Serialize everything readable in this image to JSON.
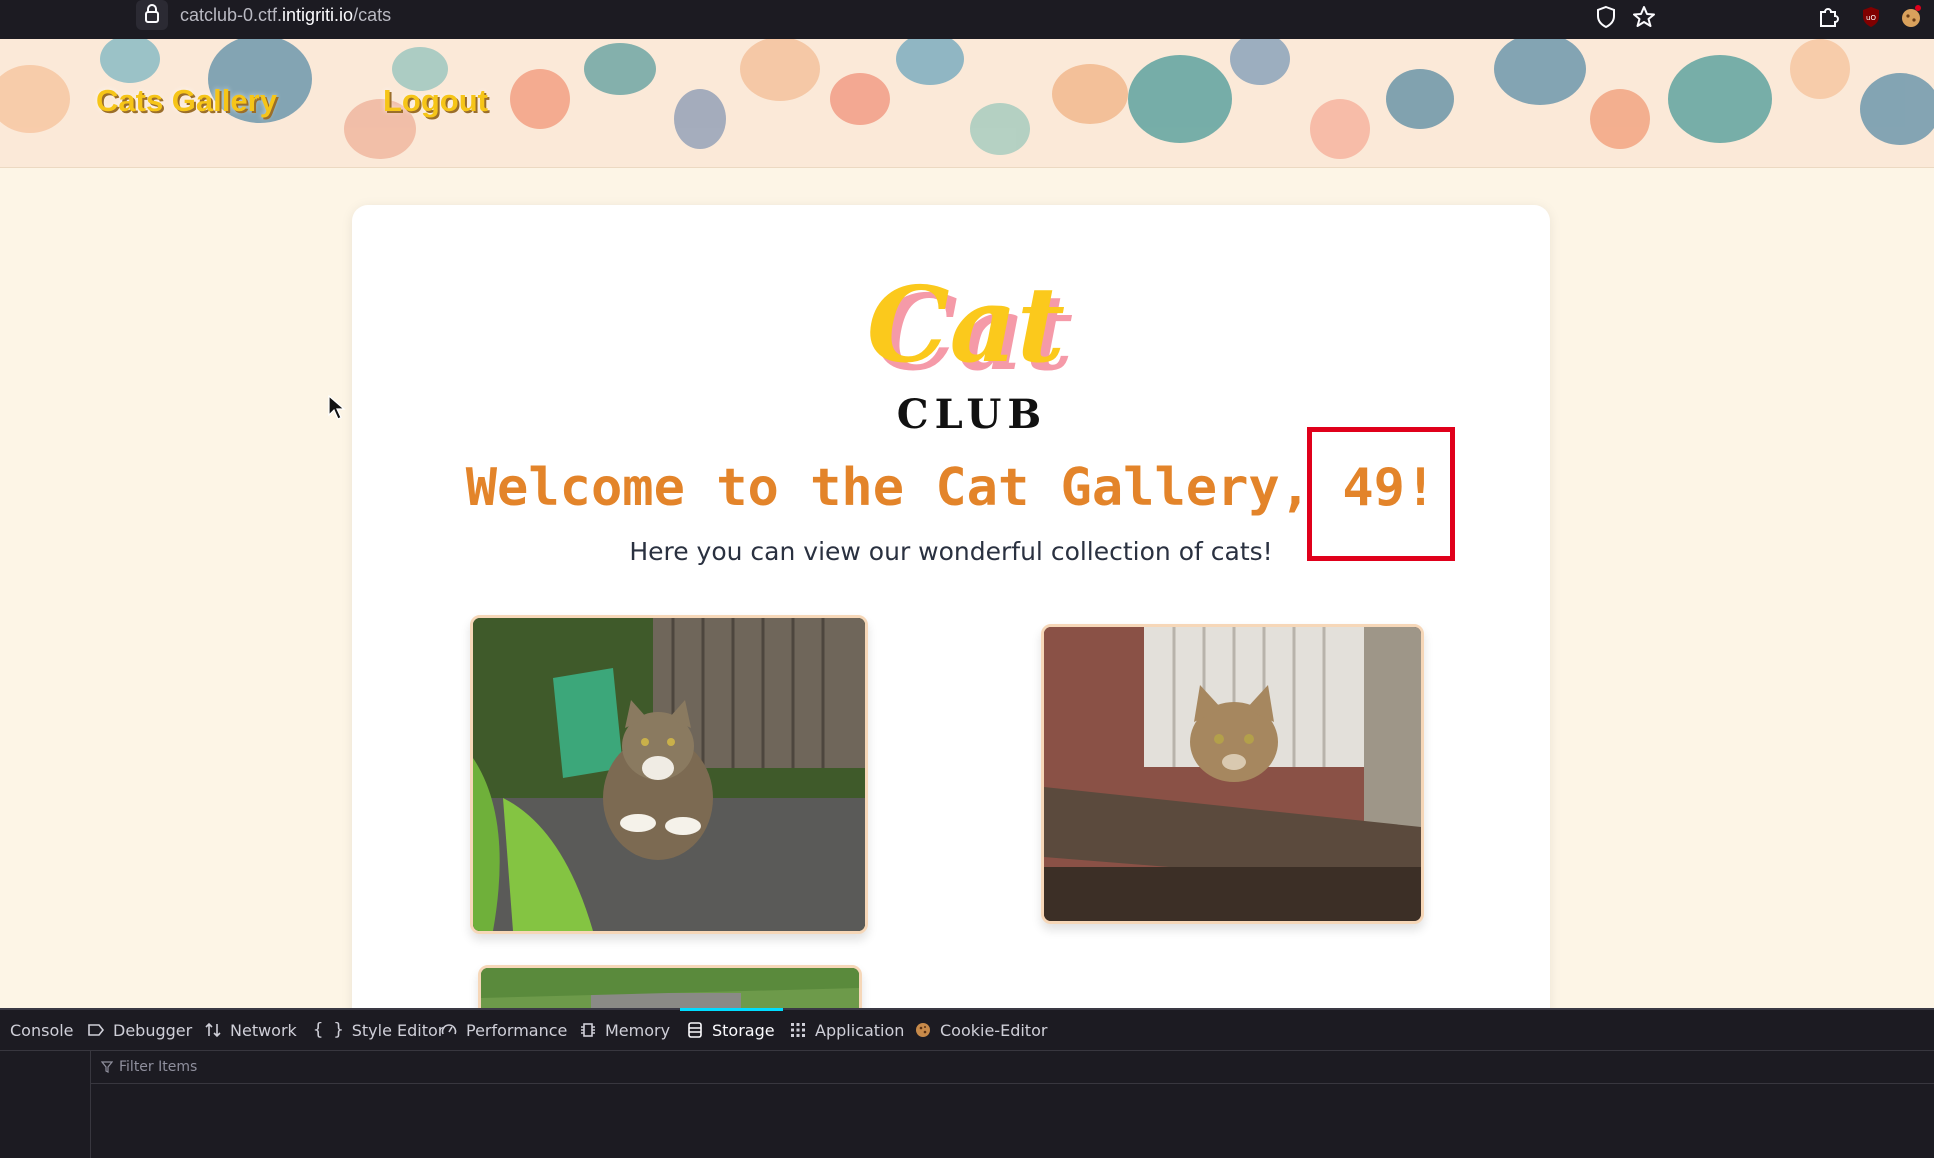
{
  "browser": {
    "url_prefix": "catclub-0.ctf.",
    "url_host": "intigriti.io",
    "url_path": "/cats"
  },
  "nav": {
    "items": [
      {
        "label": "Cats Gallery"
      },
      {
        "label": "Logout"
      }
    ]
  },
  "main": {
    "logo": {
      "word1": "Cat",
      "word2": "CLUB"
    },
    "welcome_prefix": "Welcome to the Cat Gallery,",
    "welcome_user": " 49!",
    "subtitle": "Here you can view our wonderful collection of cats!"
  },
  "devtools": {
    "tabs": [
      {
        "label": "Console",
        "icon": "console-icon"
      },
      {
        "label": "Debugger",
        "icon": "debugger-icon"
      },
      {
        "label": "Network",
        "icon": "network-icon"
      },
      {
        "label": "Style Editor",
        "icon": "style-editor-icon"
      },
      {
        "label": "Performance",
        "icon": "performance-icon"
      },
      {
        "label": "Memory",
        "icon": "memory-icon"
      },
      {
        "label": "Storage",
        "icon": "storage-icon",
        "active": true
      },
      {
        "label": "Application",
        "icon": "application-icon"
      },
      {
        "label": "Cookie-Editor",
        "icon": "cookie-icon"
      }
    ],
    "filter_placeholder": "Filter Items"
  },
  "colors": {
    "accent_orange": "#e3842a",
    "nav_yellow": "#f6c518",
    "highlight_red": "#e0001b",
    "devtools_bg": "#1c1b22",
    "active_tab": "#00ddff"
  }
}
